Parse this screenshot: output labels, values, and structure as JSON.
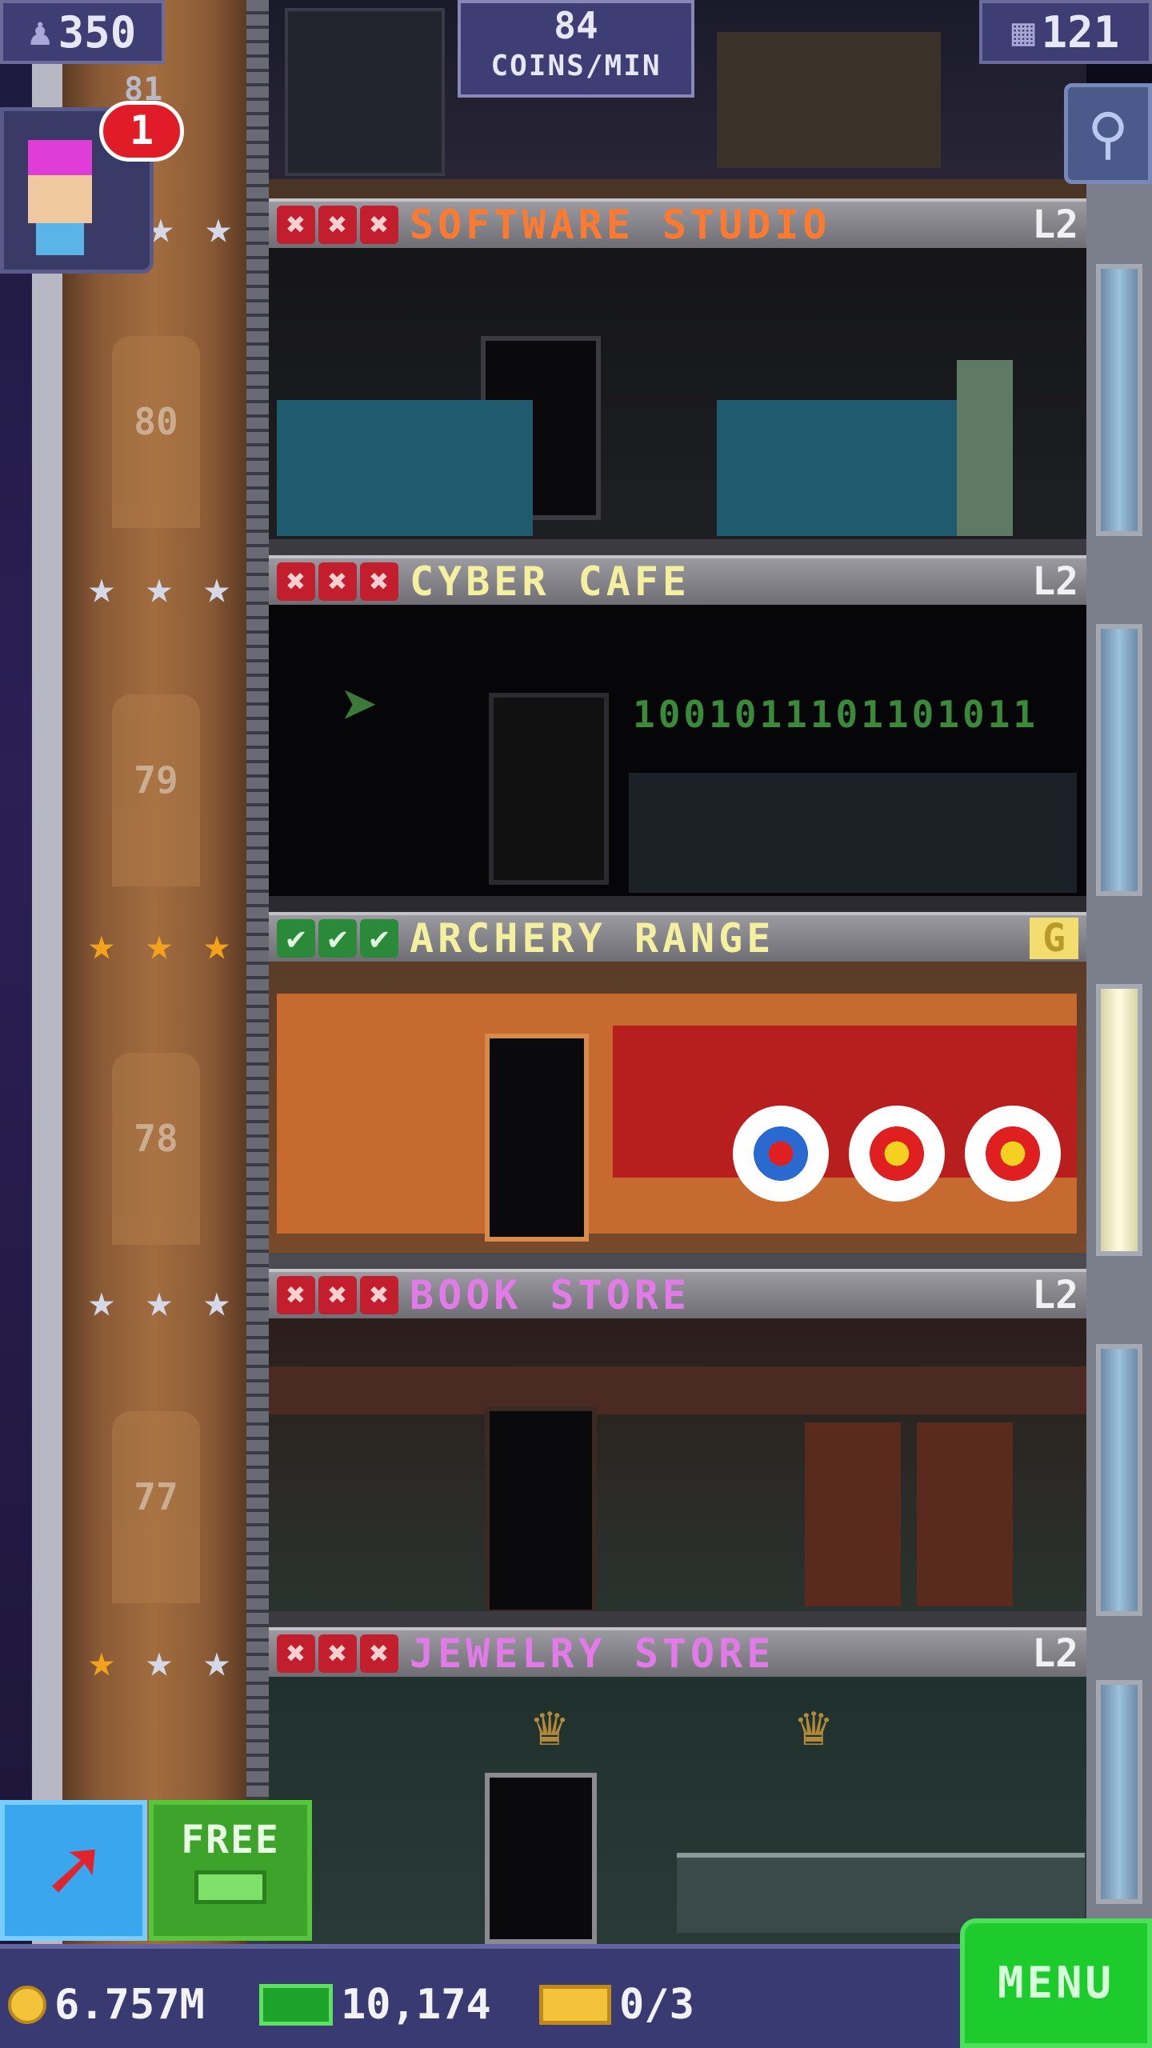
{
  "hud": {
    "population": "350",
    "coins_rate_value": "84",
    "coins_rate_unit": "COINS/MIN",
    "floor_count": "121"
  },
  "visitor": {
    "badge_count": "1",
    "floor_label": "81"
  },
  "floors": [
    {
      "number": "81",
      "name": "SOFTWARE STUDIO",
      "level": "L2",
      "name_color": "#ff7a2e",
      "stars": [
        "silver",
        "silver",
        "silver"
      ],
      "marks": [
        "x",
        "x",
        "x"
      ]
    },
    {
      "number": "80",
      "name": "CYBER CAFE",
      "level": "L2",
      "name_color": "#f4f0a0",
      "stars": [
        "silver",
        "silver",
        "silver"
      ],
      "marks": [
        "x",
        "x",
        "x"
      ],
      "binary_text": "1001011101101011"
    },
    {
      "number": "79",
      "name": "ARCHERY RANGE",
      "level": "G",
      "name_color": "#f4f0a0",
      "stars": [
        "gold",
        "gold",
        "gold"
      ],
      "marks": [
        "check",
        "check",
        "check"
      ]
    },
    {
      "number": "78",
      "name": "BOOK STORE",
      "level": "L2",
      "name_color": "#e27ae8",
      "stars": [
        "silver",
        "silver",
        "silver"
      ],
      "marks": [
        "x",
        "x",
        "x"
      ]
    },
    {
      "number": "77",
      "name": "JEWELRY STORE",
      "level": "L2",
      "name_color": "#e27ae8",
      "stars": [
        "gold",
        "silver",
        "silver"
      ],
      "marks": [
        "x",
        "x",
        "x"
      ]
    }
  ],
  "bottom": {
    "coins": "6.757M",
    "bux": "10,174",
    "tickets": "0/3",
    "free_label": "FREE",
    "menu_label": "MENU"
  },
  "icons": {
    "population": "person-icon",
    "floors": "building-icon",
    "search": "magnifier-icon",
    "elevator": "arrow-up-right-icon",
    "coin": "coin-icon",
    "bux": "tower-bux-icon",
    "ticket": "ticket-icon"
  },
  "colors": {
    "hud_bg": "#3e3e74",
    "menu_green": "#1ecb2c",
    "badge_red": "#e01c28"
  }
}
